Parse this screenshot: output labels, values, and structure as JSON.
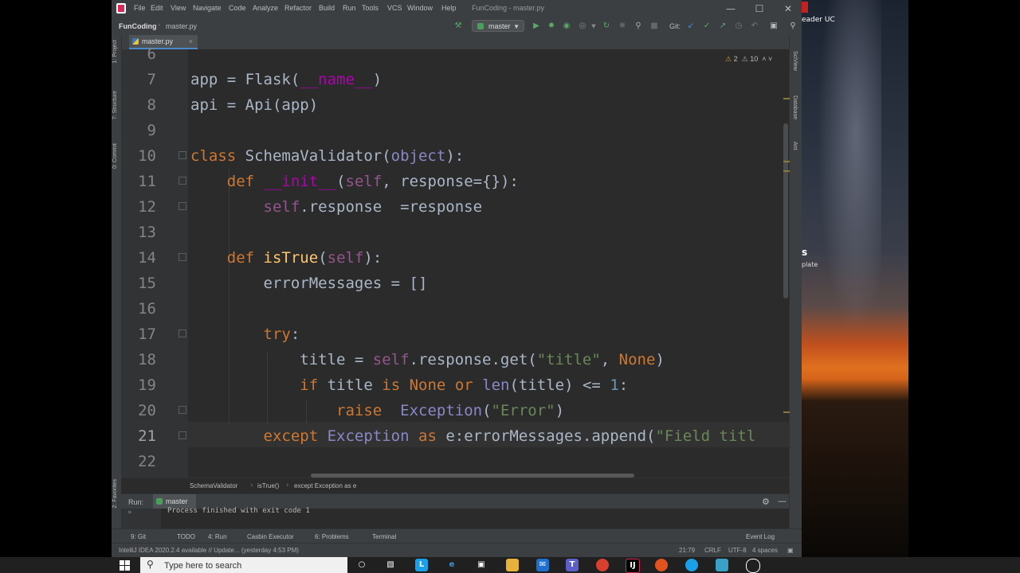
{
  "window": {
    "title": "FunCoding - master.py"
  },
  "menu": [
    "File",
    "Edit",
    "View",
    "Navigate",
    "Code",
    "Analyze",
    "Refactor",
    "Build",
    "Run",
    "Tools",
    "VCS",
    "Window",
    "Help"
  ],
  "navbar": {
    "project": "FunCoding",
    "file": "master.py",
    "run_config": "master",
    "git_label": "Git:"
  },
  "tabs": [
    {
      "label": "master.py",
      "close": "×"
    }
  ],
  "left_stripe": [
    "1: Project",
    "7: Structure",
    "0: Commit",
    "2: Favorites"
  ],
  "right_stripe": [
    "SciView",
    "Database",
    "Ant"
  ],
  "inspections": {
    "warnings": "2",
    "weak_warnings": "10"
  },
  "editor": {
    "current_line": "21",
    "lines": [
      {
        "n": "6",
        "text": ""
      },
      {
        "n": "7",
        "text": "app = Flask(__name__)"
      },
      {
        "n": "8",
        "text": "api = Api(app)"
      },
      {
        "n": "9",
        "text": ""
      },
      {
        "n": "10",
        "text": "class SchemaValidator(object):"
      },
      {
        "n": "11",
        "text": "    def __init__(self, response={}):"
      },
      {
        "n": "12",
        "text": "        self.response  =response"
      },
      {
        "n": "13",
        "text": ""
      },
      {
        "n": "14",
        "text": "    def isTrue(self):"
      },
      {
        "n": "15",
        "text": "        errorMessages = []"
      },
      {
        "n": "16",
        "text": ""
      },
      {
        "n": "17",
        "text": "        try:"
      },
      {
        "n": "18",
        "text": "            title = self.response.get(\"title\", None)"
      },
      {
        "n": "19",
        "text": "            if title is None or len(title) <= 1:"
      },
      {
        "n": "20",
        "text": "                raise  Exception(\"Error\")"
      },
      {
        "n": "21",
        "text": "        except Exception as e:errorMessages.append(\"Field titl"
      },
      {
        "n": "22",
        "text": ""
      }
    ]
  },
  "breadcrumbs": [
    "SchemaValidator",
    "isTrue()",
    "except Exception as e"
  ],
  "run_panel": {
    "label": "Run:",
    "tab": "master",
    "output": "Process finished with exit code 1"
  },
  "tool_windows": [
    "9: Git",
    "TODO",
    "4: Run",
    "Casbin Executor",
    "6: Problems",
    "Terminal",
    "Event Log"
  ],
  "status": {
    "message": "IntelliJ IDEA 2020.2.4 available // Update... (yesterday 4:53 PM)",
    "position": "21:79",
    "line_sep": "CRLF",
    "encoding": "UTF-8",
    "indent": "4 spaces"
  },
  "taskbar": {
    "search_placeholder": "Type here to search"
  },
  "desktop": {
    "text1": "eader UC",
    "text2": "s",
    "text3": "plate"
  },
  "colors": {
    "keyword": "#cc7832",
    "function": "#ffc66d",
    "self": "#94558d",
    "string": "#6a8759",
    "number": "#6897bb",
    "builtin": "#8888c6",
    "magic": "#b200b2"
  }
}
